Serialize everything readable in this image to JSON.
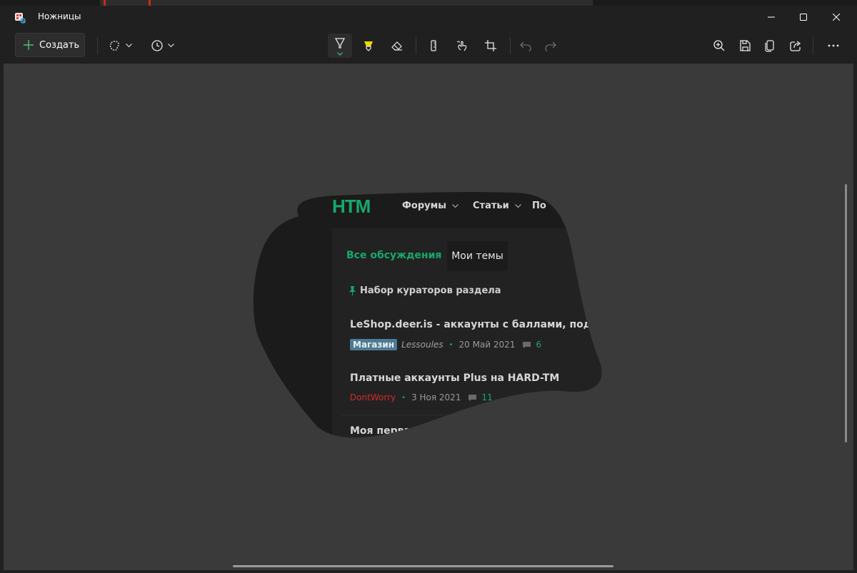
{
  "window": {
    "title": "Ножницы"
  },
  "toolbar": {
    "new_label": "Создать",
    "icons": [
      "freeform-shape-icon",
      "timer-icon",
      "pen-icon",
      "highlighter-icon",
      "eraser-icon",
      "ruler-icon",
      "touch-write-icon",
      "crop-icon",
      "undo-icon",
      "redo-icon",
      "zoom-in-icon",
      "save-icon",
      "copy-icon",
      "share-icon",
      "more-icon"
    ]
  },
  "snip": {
    "logo": "HTM",
    "nav": [
      "Форумы",
      "Статьи",
      "По"
    ],
    "tabs": {
      "all": "Все обсуждения",
      "mine": "Мои темы"
    },
    "pinned": "Набор кураторов раздела",
    "threads": [
      {
        "title": "LeShop.deer.is - аккаунты с баллами, подписками",
        "badge": "Магазин",
        "author": "Lessoules",
        "date": "20 Май 2021",
        "comments": "6"
      },
      {
        "title": "Платные аккаунты Plus на HARD-TM",
        "author": "DontWorry",
        "date": "3 Ноя 2021",
        "comments": "11"
      },
      {
        "title": "Моя первая"
      }
    ]
  },
  "colors": {
    "accent": "#17a86b",
    "badge": "#4d7b93",
    "author_red": "#d12b2b",
    "canvas": "#3a3a3a",
    "chrome": "#202020"
  }
}
